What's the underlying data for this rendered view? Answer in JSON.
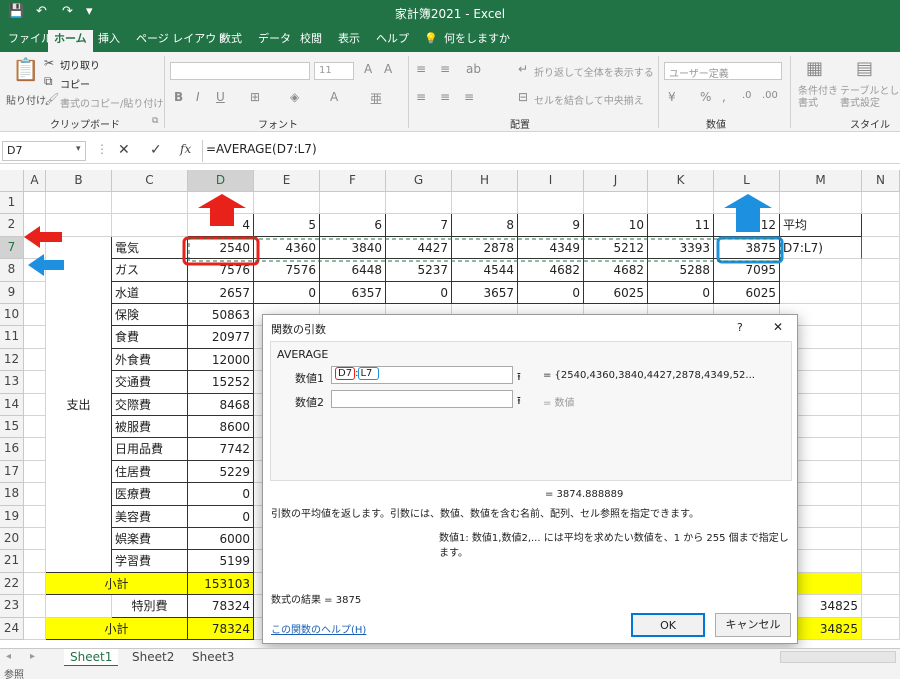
{
  "window": {
    "title": "家計簿2021  -  Excel"
  },
  "quick_access": {
    "save": "💾",
    "undo": "↶",
    "redo": "↷",
    "more": "▾"
  },
  "ribbon_tabs": [
    "ファイル",
    "ホーム",
    "挿入",
    "ページ レイアウト",
    "数式",
    "データ",
    "校閲",
    "表示",
    "ヘルプ",
    "何をしますか"
  ],
  "ribbon": {
    "clipboard": {
      "paste": "貼り付け",
      "cut": "切り取り",
      "copy": "コピー",
      "format_painter": "書式のコピー/貼り付け",
      "label": "クリップボード"
    },
    "font": {
      "size": "11",
      "label": "フォント"
    },
    "alignment": {
      "wrap": "折り返して全体を表示する",
      "merge": "セルを結合して中央揃え",
      "label": "配置"
    },
    "number": {
      "format": "ユーザー定義",
      "label": "数値"
    },
    "styles": {
      "conditional": "条件付き\n書式",
      "table": "テーブルとして\n書式設定",
      "label": "スタイル"
    }
  },
  "formula_bar": {
    "name_box": "D7",
    "formula": "=AVERAGE(D7:L7)"
  },
  "columns": [
    "A",
    "B",
    "C",
    "D",
    "E",
    "F",
    "G",
    "H",
    "I",
    "J",
    "K",
    "L",
    "M",
    "N"
  ],
  "rows": [
    "1",
    "2",
    "7",
    "8",
    "9",
    "10",
    "11",
    "12",
    "13",
    "14",
    "15",
    "16",
    "17",
    "18",
    "19",
    "20",
    "21",
    "22",
    "23",
    "24"
  ],
  "sheet": {
    "row2": [
      "",
      "",
      "4",
      "5",
      "6",
      "7",
      "8",
      "9",
      "10",
      "11",
      "12",
      "平均"
    ],
    "row7": {
      "label": "電気",
      "values": [
        "2540",
        "4360",
        "3840",
        "4427",
        "2878",
        "4349",
        "5212",
        "3393",
        "3875"
      ],
      "m": "D7:L7)"
    },
    "row8": {
      "label": "ガス",
      "values": [
        "7576",
        "7576",
        "6448",
        "5237",
        "4544",
        "4682",
        "4682",
        "5288",
        "7095"
      ]
    },
    "row9": {
      "label": "水道",
      "values": [
        "2657",
        "0",
        "6357",
        "0",
        "3657",
        "0",
        "6025",
        "0",
        "6025"
      ]
    },
    "items": [
      {
        "label": "保険",
        "d": "50863"
      },
      {
        "label": "食費",
        "d": "20977"
      },
      {
        "label": "外食費",
        "d": "12000"
      },
      {
        "label": "交通費",
        "d": "15252"
      },
      {
        "label": "交際費",
        "d": "8468"
      },
      {
        "label": "被服費",
        "d": "8600"
      },
      {
        "label": "日用品費",
        "d": "7742"
      },
      {
        "label": "住居費",
        "d": "5229"
      },
      {
        "label": "医療費",
        "d": "0"
      },
      {
        "label": "美容費",
        "d": "0"
      },
      {
        "label": "娯楽費",
        "d": "6000"
      },
      {
        "label": "学習費",
        "d": "5199"
      }
    ],
    "group_label": "支出",
    "subtotal1": {
      "label": "小計",
      "d": "153103"
    },
    "special": {
      "label": "特別費",
      "d": "78324",
      "m": "34825"
    },
    "subtotal2": {
      "label": "小計",
      "d": "78324",
      "m": "34825"
    }
  },
  "dialog": {
    "title": "関数の引数",
    "help": "?",
    "close": "✕",
    "function_name": "AVERAGE",
    "arg1_label": "数値1",
    "arg1_ref_start": "D7",
    "arg1_ref_end": "L7",
    "arg1_result": "= {2540,4360,3840,4427,2878,4349,52...",
    "arg2_label": "数値2",
    "arg2_result": "= 数値",
    "collapse_icon": "⭱",
    "result_value": "= 3874.888889",
    "description": "引数の平均値を返します。引数には、数値、数値を含む名前、配列、セル参照を指定できます。",
    "arg_description": "数値1:  数値1,数値2,... には平均を求めたい数値を、1 から 255 個まで指定します。",
    "formula_result": "数式の結果 =  3875",
    "help_link": "この関数のヘルプ(H)",
    "ok": "OK",
    "cancel": "キャンセル"
  },
  "sheet_tabs": [
    "Sheet1",
    "Sheet2",
    "Sheet3"
  ],
  "status": "参照",
  "colors": {
    "excel_green": "#217346",
    "red_marker": "#e8221b",
    "blue_marker": "#1e90e0",
    "yellow_fill": "#ffff00"
  }
}
